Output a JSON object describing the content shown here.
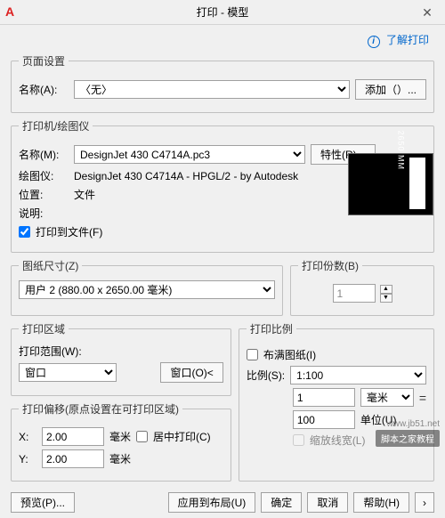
{
  "title": "打印 - 模型",
  "info_link": "了解打印",
  "page_setup": {
    "legend": "页面设置",
    "name_label": "名称(A):",
    "name_value": "〈无〉",
    "add_btn": "添加（）..."
  },
  "printer": {
    "legend": "打印机/绘图仪",
    "name_label": "名称(M):",
    "name_value": "DesignJet 430 C4714A.pc3",
    "props_btn": "特性(R)...",
    "plotter_label": "绘图仪:",
    "plotter_value": "DesignJet 430 C4714A - HPGL/2 - by Autodesk",
    "location_label": "位置:",
    "location_value": "文件",
    "desc_label": "说明:",
    "to_file": "打印到文件(F)",
    "preview_dim": "2650 MM"
  },
  "paper": {
    "legend": "图纸尺寸(Z)",
    "value": "用户 2 (880.00 x 2650.00 毫米)"
  },
  "copies": {
    "legend": "打印份数(B)",
    "value": "1"
  },
  "area": {
    "legend": "打印区域",
    "range_label": "打印范围(W):",
    "range_value": "窗口",
    "window_btn": "窗口(O)<"
  },
  "scale": {
    "legend": "打印比例",
    "fit": "布满图纸(I)",
    "ratio_label": "比例(S):",
    "ratio_value": "1:100",
    "unit1_value": "1",
    "unit1": "毫米",
    "unit2_value": "100",
    "unit2": "单位(U)",
    "lineweight": "缩放线宽(L)"
  },
  "offset": {
    "legend": "打印偏移(原点设置在可打印区域)",
    "x_label": "X:",
    "x_value": "2.00",
    "y_label": "Y:",
    "y_value": "2.00",
    "unit": "毫米",
    "center": "居中打印(C)"
  },
  "buttons": {
    "preview": "预览(P)...",
    "apply": "应用到布局(U)",
    "ok": "确定",
    "cancel": "取消",
    "help": "帮助(H)"
  },
  "watermark1": "www.jb51.net",
  "watermark2": "脚本之家教程"
}
